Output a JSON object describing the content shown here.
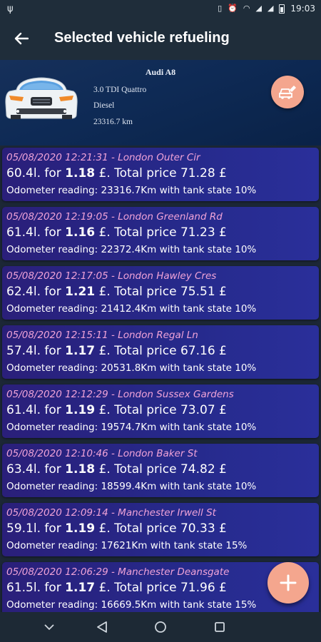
{
  "status_bar": {
    "time": "19:03"
  },
  "app_bar": {
    "title": "Selected vehicle refueling"
  },
  "vehicle": {
    "name": "Audi A8",
    "engine": "3.0 TDI Quattro",
    "fuel": "Diesel",
    "mileage": "23316.7 km"
  },
  "refuelings": [
    {
      "header": "05/08/2020 12:21:31 - London Outer Cir",
      "qty": "60.4l. for ",
      "unit_price": "1.18",
      "total": " £. Total price 71.28 £",
      "odometer": "Odometer reading: 23316.7Km with tank state 10%"
    },
    {
      "header": "05/08/2020 12:19:05 - London Greenland Rd",
      "qty": "61.4l. for ",
      "unit_price": "1.16",
      "total": " £. Total price 71.23 £",
      "odometer": "Odometer reading: 22372.4Km with tank state 10%"
    },
    {
      "header": "05/08/2020 12:17:05 - London Hawley Cres",
      "qty": "62.4l. for ",
      "unit_price": "1.21",
      "total": " £. Total price 75.51 £",
      "odometer": "Odometer reading: 21412.4Km with tank state 10%"
    },
    {
      "header": "05/08/2020 12:15:11 - London Regal Ln",
      "qty": "57.4l. for ",
      "unit_price": "1.17",
      "total": " £. Total price 67.16 £",
      "odometer": "Odometer reading: 20531.8Km with tank state 10%"
    },
    {
      "header": "05/08/2020 12:12:29 - London Sussex Gardens",
      "qty": "61.4l. for ",
      "unit_price": "1.19",
      "total": " £. Total price 73.07 £",
      "odometer": "Odometer reading: 19574.7Km with tank state 10%"
    },
    {
      "header": "05/08/2020 12:10:46 - London Baker St",
      "qty": "63.4l. for ",
      "unit_price": "1.18",
      "total": " £. Total price 74.82 £",
      "odometer": "Odometer reading: 18599.4Km with tank state 10%"
    },
    {
      "header": "05/08/2020 12:09:14 - Manchester Irwell St",
      "qty": "59.1l. for ",
      "unit_price": "1.19",
      "total": " £. Total price 70.33 £",
      "odometer": "Odometer reading: 17621Km with tank state 15%"
    },
    {
      "header": "05/08/2020 12:06:29 - Manchester Deansgate",
      "qty": "61.5l. for ",
      "unit_price": "1.17",
      "total": " £. Total price 71.96 £",
      "odometer": "Odometer reading: 16669.5Km with tank state 15%"
    }
  ],
  "colors": {
    "accent_fab": "#f4a68e",
    "card_date": "#f0a3d8",
    "card_bg": "#2a2a8c",
    "header_bg": "#0e2a55",
    "app_bar": "#1f2d3a"
  },
  "icons": {
    "back": "arrow-left-icon",
    "edit_vehicle": "car-edit-icon",
    "add": "plus-icon",
    "nav": [
      "chevron-down-icon",
      "back-triangle-icon",
      "home-circle-icon",
      "recents-square-icon"
    ]
  }
}
